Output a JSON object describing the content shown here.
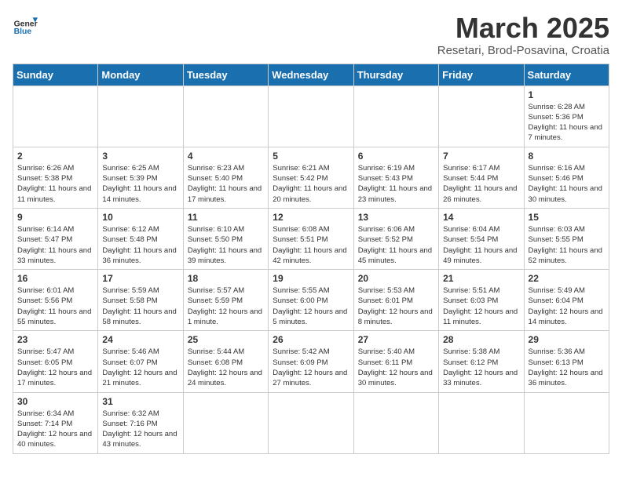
{
  "header": {
    "logo_general": "General",
    "logo_blue": "Blue",
    "title": "March 2025",
    "subtitle": "Resetari, Brod-Posavina, Croatia"
  },
  "weekdays": [
    "Sunday",
    "Monday",
    "Tuesday",
    "Wednesday",
    "Thursday",
    "Friday",
    "Saturday"
  ],
  "weeks": [
    [
      {
        "day": "",
        "info": ""
      },
      {
        "day": "",
        "info": ""
      },
      {
        "day": "",
        "info": ""
      },
      {
        "day": "",
        "info": ""
      },
      {
        "day": "",
        "info": ""
      },
      {
        "day": "",
        "info": ""
      },
      {
        "day": "1",
        "info": "Sunrise: 6:28 AM\nSunset: 5:36 PM\nDaylight: 11 hours\nand 7 minutes."
      }
    ],
    [
      {
        "day": "2",
        "info": "Sunrise: 6:26 AM\nSunset: 5:38 PM\nDaylight: 11 hours\nand 11 minutes."
      },
      {
        "day": "3",
        "info": "Sunrise: 6:25 AM\nSunset: 5:39 PM\nDaylight: 11 hours\nand 14 minutes."
      },
      {
        "day": "4",
        "info": "Sunrise: 6:23 AM\nSunset: 5:40 PM\nDaylight: 11 hours\nand 17 minutes."
      },
      {
        "day": "5",
        "info": "Sunrise: 6:21 AM\nSunset: 5:42 PM\nDaylight: 11 hours\nand 20 minutes."
      },
      {
        "day": "6",
        "info": "Sunrise: 6:19 AM\nSunset: 5:43 PM\nDaylight: 11 hours\nand 23 minutes."
      },
      {
        "day": "7",
        "info": "Sunrise: 6:17 AM\nSunset: 5:44 PM\nDaylight: 11 hours\nand 26 minutes."
      },
      {
        "day": "8",
        "info": "Sunrise: 6:16 AM\nSunset: 5:46 PM\nDaylight: 11 hours\nand 30 minutes."
      }
    ],
    [
      {
        "day": "9",
        "info": "Sunrise: 6:14 AM\nSunset: 5:47 PM\nDaylight: 11 hours\nand 33 minutes."
      },
      {
        "day": "10",
        "info": "Sunrise: 6:12 AM\nSunset: 5:48 PM\nDaylight: 11 hours\nand 36 minutes."
      },
      {
        "day": "11",
        "info": "Sunrise: 6:10 AM\nSunset: 5:50 PM\nDaylight: 11 hours\nand 39 minutes."
      },
      {
        "day": "12",
        "info": "Sunrise: 6:08 AM\nSunset: 5:51 PM\nDaylight: 11 hours\nand 42 minutes."
      },
      {
        "day": "13",
        "info": "Sunrise: 6:06 AM\nSunset: 5:52 PM\nDaylight: 11 hours\nand 45 minutes."
      },
      {
        "day": "14",
        "info": "Sunrise: 6:04 AM\nSunset: 5:54 PM\nDaylight: 11 hours\nand 49 minutes."
      },
      {
        "day": "15",
        "info": "Sunrise: 6:03 AM\nSunset: 5:55 PM\nDaylight: 11 hours\nand 52 minutes."
      }
    ],
    [
      {
        "day": "16",
        "info": "Sunrise: 6:01 AM\nSunset: 5:56 PM\nDaylight: 11 hours\nand 55 minutes."
      },
      {
        "day": "17",
        "info": "Sunrise: 5:59 AM\nSunset: 5:58 PM\nDaylight: 11 hours\nand 58 minutes."
      },
      {
        "day": "18",
        "info": "Sunrise: 5:57 AM\nSunset: 5:59 PM\nDaylight: 12 hours\nand 1 minute."
      },
      {
        "day": "19",
        "info": "Sunrise: 5:55 AM\nSunset: 6:00 PM\nDaylight: 12 hours\nand 5 minutes."
      },
      {
        "day": "20",
        "info": "Sunrise: 5:53 AM\nSunset: 6:01 PM\nDaylight: 12 hours\nand 8 minutes."
      },
      {
        "day": "21",
        "info": "Sunrise: 5:51 AM\nSunset: 6:03 PM\nDaylight: 12 hours\nand 11 minutes."
      },
      {
        "day": "22",
        "info": "Sunrise: 5:49 AM\nSunset: 6:04 PM\nDaylight: 12 hours\nand 14 minutes."
      }
    ],
    [
      {
        "day": "23",
        "info": "Sunrise: 5:47 AM\nSunset: 6:05 PM\nDaylight: 12 hours\nand 17 minutes."
      },
      {
        "day": "24",
        "info": "Sunrise: 5:46 AM\nSunset: 6:07 PM\nDaylight: 12 hours\nand 21 minutes."
      },
      {
        "day": "25",
        "info": "Sunrise: 5:44 AM\nSunset: 6:08 PM\nDaylight: 12 hours\nand 24 minutes."
      },
      {
        "day": "26",
        "info": "Sunrise: 5:42 AM\nSunset: 6:09 PM\nDaylight: 12 hours\nand 27 minutes."
      },
      {
        "day": "27",
        "info": "Sunrise: 5:40 AM\nSunset: 6:11 PM\nDaylight: 12 hours\nand 30 minutes."
      },
      {
        "day": "28",
        "info": "Sunrise: 5:38 AM\nSunset: 6:12 PM\nDaylight: 12 hours\nand 33 minutes."
      },
      {
        "day": "29",
        "info": "Sunrise: 5:36 AM\nSunset: 6:13 PM\nDaylight: 12 hours\nand 36 minutes."
      }
    ],
    [
      {
        "day": "30",
        "info": "Sunrise: 6:34 AM\nSunset: 7:14 PM\nDaylight: 12 hours\nand 40 minutes."
      },
      {
        "day": "31",
        "info": "Sunrise: 6:32 AM\nSunset: 7:16 PM\nDaylight: 12 hours\nand 43 minutes."
      },
      {
        "day": "",
        "info": ""
      },
      {
        "day": "",
        "info": ""
      },
      {
        "day": "",
        "info": ""
      },
      {
        "day": "",
        "info": ""
      },
      {
        "day": "",
        "info": ""
      }
    ]
  ]
}
